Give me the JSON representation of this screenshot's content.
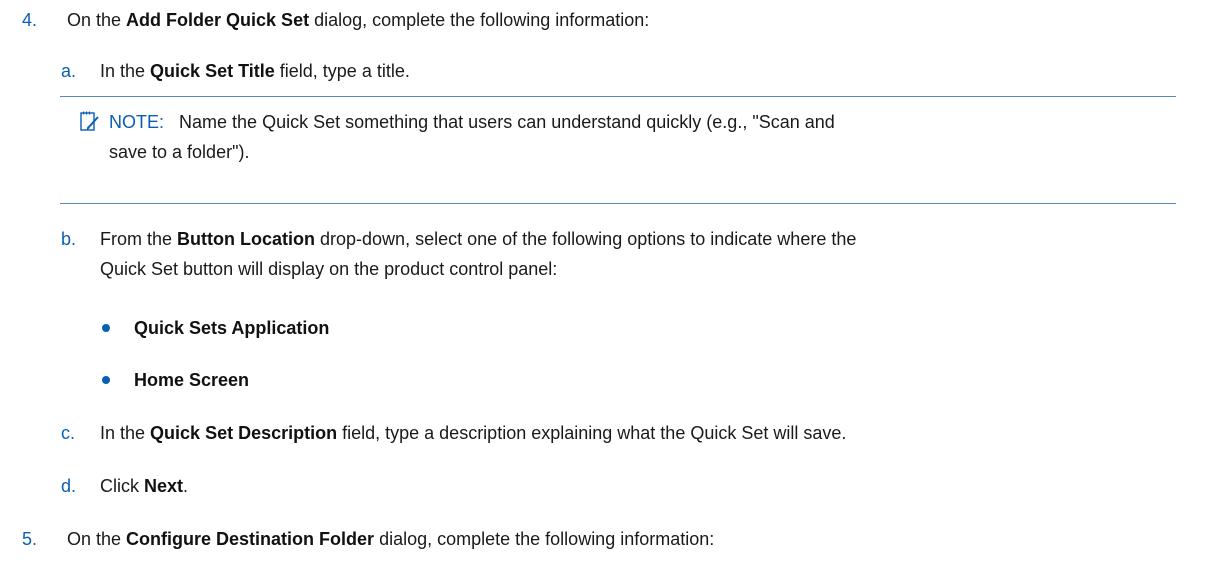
{
  "step4": {
    "number": "4.",
    "pre": "On the ",
    "bold": "Add Folder Quick Set",
    "post": " dialog, complete the following information:"
  },
  "step4a": {
    "letter": "a.",
    "pre": "In the ",
    "bold": "Quick Set Title",
    "post": " field, type a title."
  },
  "note": {
    "label": "NOTE:",
    "line1": "Name the Quick Set something that users can understand quickly (e.g., \"Scan and",
    "line2": "save to a folder\").",
    "icon": "note-pencil-icon",
    "border_color": "#5b87c2"
  },
  "step4b": {
    "letter": "b.",
    "pre": "From the ",
    "bold": "Button Location",
    "post": " drop-down, select one of the following options to indicate where the",
    "line2": "Quick Set button will display on the product control panel:"
  },
  "bullets": [
    "Quick Sets Application",
    "Home Screen"
  ],
  "step4c": {
    "letter": "c.",
    "pre": "In the ",
    "bold": "Quick Set Description",
    "post": " field, type a description explaining what the Quick Set will save."
  },
  "step4d": {
    "letter": "d.",
    "pre": "Click ",
    "bold": "Next",
    "post": "."
  },
  "step5": {
    "number": "5.",
    "pre": "On the ",
    "bold": "Configure Destination Folder",
    "post": " dialog, complete the following information:"
  },
  "colors": {
    "accent": "#0a5fb4",
    "text": "#1a1a1a"
  }
}
